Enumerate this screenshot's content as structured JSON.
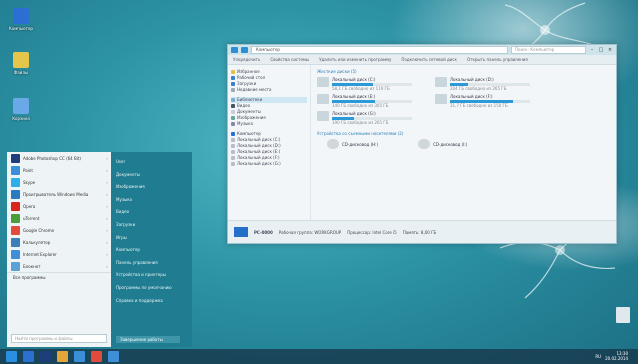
{
  "desktop": {
    "icons": [
      {
        "label": "Компьютер",
        "color": "#2a6fd1"
      },
      {
        "label": "Файлы",
        "color": "#e3c64a"
      },
      {
        "label": "Корзина",
        "color": "#6aa9e8"
      }
    ]
  },
  "explorer": {
    "address": "Компьютер",
    "search_placeholder": "Поиск: Компьютер",
    "ribbon": [
      "Упорядочить",
      "Свойства системы",
      "Удалить или изменить программу",
      "Подключить сетевой диск",
      "Открыть панель управления"
    ],
    "nav": {
      "favorites": [
        "Избранное",
        "Рабочий стол",
        "Загрузки",
        "Недавние места"
      ],
      "libraries": [
        "Библиотеки",
        "Видео",
        "Документы",
        "Изображения",
        "Музыка"
      ],
      "computer": [
        "Компьютер",
        "Локальный диск (C:)",
        "Локальный диск (D:)",
        "Локальный диск (E:)",
        "Локальный диск (F:)",
        "Локальный диск (G:)"
      ]
    },
    "group_hdd": "Жесткие диски (5)",
    "drives": [
      {
        "name": "Локальный диск (C:)",
        "info": "58,1 ГБ свободно из 119 ГБ",
        "fill": 0.51
      },
      {
        "name": "Локальный диск (D:)",
        "info": "204 ГБ свободно из 265 ГБ",
        "fill": 0.23
      },
      {
        "name": "Локальный диск (E:)",
        "info": "140 ГБ свободно из 305 ГБ",
        "fill": 0.54
      },
      {
        "name": "Локальный диск (F:)",
        "info": "31,7 ГБ свободно из 150 ГБ",
        "fill": 0.79
      },
      {
        "name": "Локальный диск (G:)",
        "info": "190 ГБ свободно из 265 ГБ",
        "fill": 0.28
      }
    ],
    "group_removable": "Устройства со съемными носителями (2)",
    "devices": [
      "CD-дисковод (H:)",
      "CD-дисковод (I:)"
    ],
    "details": {
      "name": "PC-0000",
      "workgroup": "Рабочая группа: WORKGROUP",
      "processor": "Процессор: Intel Core i5",
      "memory": "Память: 8,00 ГБ"
    }
  },
  "start": {
    "apps": [
      {
        "label": "Adobe Photoshop CC (64 Bit)",
        "color": "#1d3e7a"
      },
      {
        "label": "Paint",
        "color": "#3a8fd8"
      },
      {
        "label": "Skype",
        "color": "#2bb0ea"
      },
      {
        "label": "Проигрыватель Windows Media",
        "color": "#2a7ac0"
      },
      {
        "label": "Opera",
        "color": "#d8241c"
      },
      {
        "label": "uTorrent",
        "color": "#4a9e3a"
      },
      {
        "label": "Google Chrome",
        "color": "#e24a3b"
      },
      {
        "label": "Калькулятор",
        "color": "#3a7fb8"
      },
      {
        "label": "Internet Explorer",
        "color": "#3f8fd8"
      },
      {
        "label": "Блокнот",
        "color": "#5aa2d6"
      }
    ],
    "all_programs": "Все программы",
    "search_placeholder": "Найти программы и файлы",
    "links": [
      "User",
      "Документы",
      "Изображения",
      "Музыка",
      "Видео",
      "Загрузки",
      "Игры",
      "Компьютер",
      "Панель управления",
      "Устройства и принтеры",
      "Программы по умолчанию",
      "Справка и поддержка"
    ],
    "shutdown_label": "Завершение работы"
  },
  "taskbar": {
    "items": [
      {
        "name": "start-button",
        "color": "#2a8fe0"
      },
      {
        "name": "explorer",
        "color": "#2a6fd1"
      },
      {
        "name": "photoshop",
        "color": "#1d3e7a"
      },
      {
        "name": "file-manager",
        "color": "#e3a63a"
      },
      {
        "name": "media-player",
        "color": "#3a8fd8"
      },
      {
        "name": "chrome",
        "color": "#e24a3b"
      },
      {
        "name": "app",
        "color": "#3f8fd8"
      }
    ],
    "lang": "RU",
    "time": "13:30",
    "date": "20.02.2014"
  }
}
